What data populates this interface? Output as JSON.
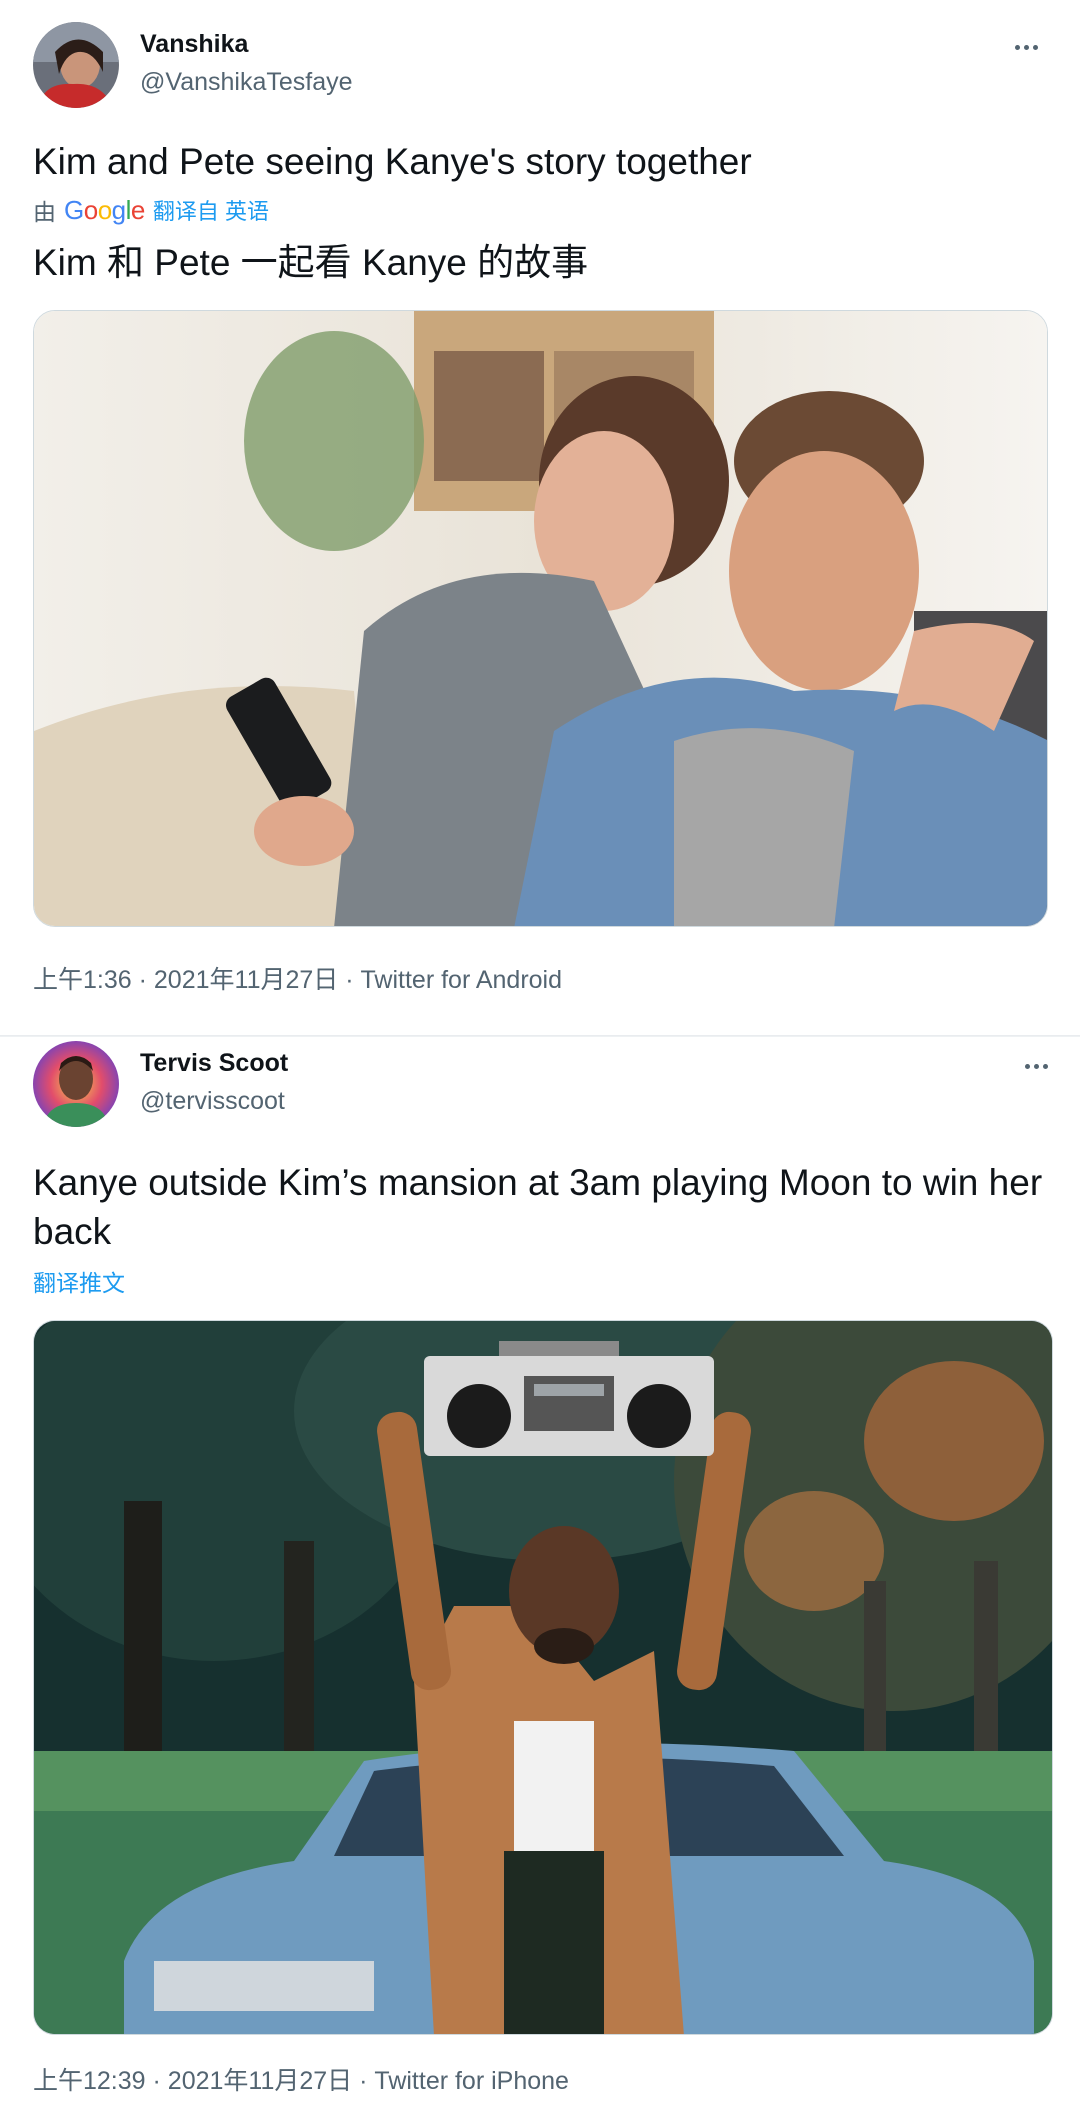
{
  "tweets": [
    {
      "display_name": "Vanshika",
      "handle": "@VanshikaTesfaye",
      "text": "Kim and Pete seeing Kanye's story together",
      "translation": {
        "by_label": "由",
        "provider": "Google",
        "link": "翻译自 英语",
        "text": "Kim 和 Pete 一起看 Kanye 的故事"
      },
      "media_icon": "couple-laughing-at-phone-photo",
      "time": "上午1:36",
      "separator": "·",
      "date": "2021年11月27日",
      "source": "Twitter for Android"
    },
    {
      "display_name": "Tervis Scoot",
      "handle": "@tervisscoot",
      "text": "Kanye outside Kim’s mansion at 3am playing Moon to win her back",
      "translate_link": "翻译推文",
      "media_icon": "man-holding-boombox-photo",
      "time": "上午12:39",
      "separator": "·",
      "date": "2021年11月27日",
      "source": "Twitter for iPhone"
    }
  ],
  "colors": {
    "text_primary": "#0f1419",
    "text_secondary": "#536471",
    "link": "#1d9bf0",
    "border": "#cfd9de"
  }
}
